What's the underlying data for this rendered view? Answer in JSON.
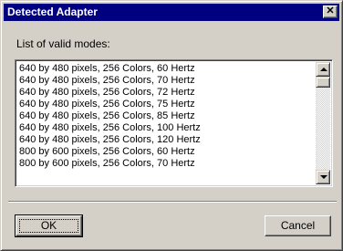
{
  "window": {
    "title": "Detected Adapter",
    "close_glyph": "✕"
  },
  "label": "List of valid modes:",
  "modes": [
    "640 by 480 pixels, 256 Colors, 60 Hertz",
    "640 by 480 pixels, 256 Colors, 70 Hertz",
    "640 by 480 pixels, 256 Colors, 72 Hertz",
    "640 by 480 pixels, 256 Colors, 75 Hertz",
    "640 by 480 pixels, 256 Colors, 85 Hertz",
    "640 by 480 pixels, 256 Colors, 100 Hertz",
    "640 by 480 pixels, 256 Colors, 120 Hertz",
    "800 by 600 pixels, 256 Colors, 60 Hertz",
    "800 by 600 pixels, 256 Colors, 70 Hertz"
  ],
  "buttons": {
    "ok": "OK",
    "cancel": "Cancel"
  },
  "colors": {
    "titlebar": "#000080",
    "face": "#d4d0c8"
  },
  "icons": {
    "close": "close-icon",
    "scroll_up": "arrow-up-icon",
    "scroll_down": "arrow-down-icon"
  }
}
